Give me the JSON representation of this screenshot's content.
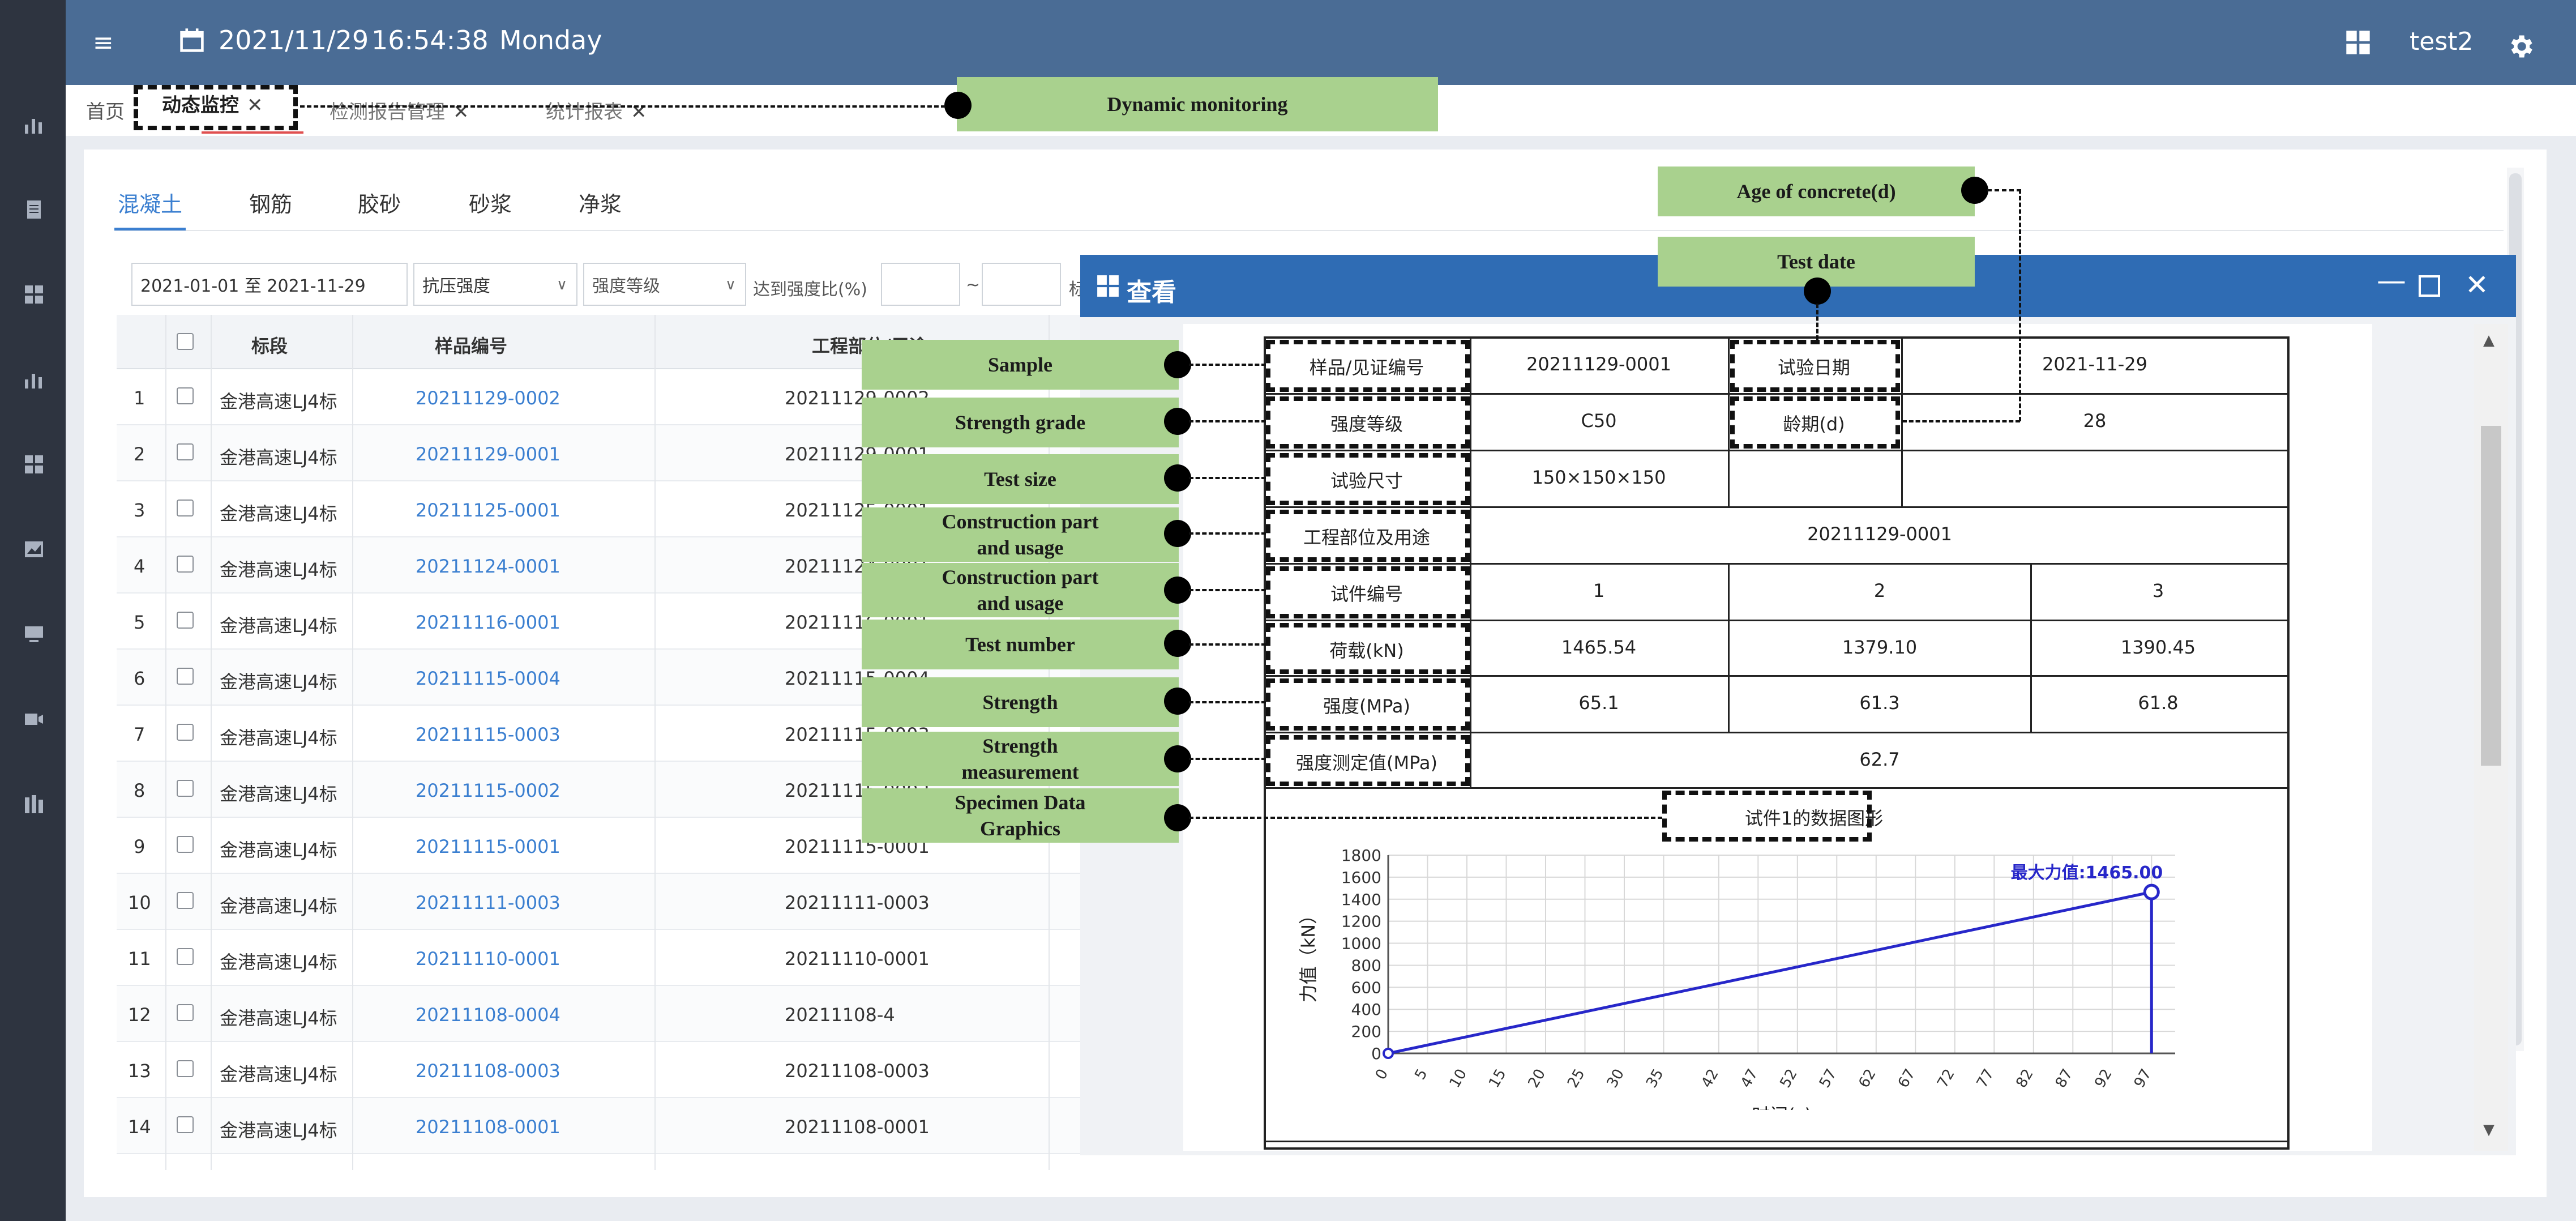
{
  "header": {
    "menu_glyph": "≡",
    "date": "2021/11/29",
    "time": "16:54:38",
    "weekday": "Monday",
    "user": "test2"
  },
  "tabs": {
    "home": "首页",
    "active": "动态监控",
    "reports": "检测报告管理",
    "stats": "统计报表",
    "close_glyph": "✕"
  },
  "subtabs": [
    "混凝土",
    "钢筋",
    "胶砂",
    "砂浆",
    "净浆"
  ],
  "filters": {
    "date_range": "2021-01-01 至 2021-11-29",
    "strength_type": "抗压强度",
    "grade_placeholder": "强度等级",
    "ratio_label": "达到强度比(%)",
    "tilde": "~",
    "cut_label": "标"
  },
  "table": {
    "headers": {
      "section": "标段",
      "sample": "样品编号",
      "part": "工程部位/用途"
    },
    "rows": [
      {
        "no": "1",
        "section": "金港高速LJ4标",
        "sample": "20211129-0002",
        "part": "20211129-0002"
      },
      {
        "no": "2",
        "section": "金港高速LJ4标",
        "sample": "20211129-0001",
        "part": "20211129-0001"
      },
      {
        "no": "3",
        "section": "金港高速LJ4标",
        "sample": "20211125-0001",
        "part": "20211125-0001"
      },
      {
        "no": "4",
        "section": "金港高速LJ4标",
        "sample": "20211124-0001",
        "part": "20211124-0001"
      },
      {
        "no": "5",
        "section": "金港高速LJ4标",
        "sample": "20211116-0001",
        "part": "20211116-0001"
      },
      {
        "no": "6",
        "section": "金港高速LJ4标",
        "sample": "20211115-0004",
        "part": "20211115-0004"
      },
      {
        "no": "7",
        "section": "金港高速LJ4标",
        "sample": "20211115-0003",
        "part": "20211115-0003"
      },
      {
        "no": "8",
        "section": "金港高速LJ4标",
        "sample": "20211115-0002",
        "part": "20211115-0002"
      },
      {
        "no": "9",
        "section": "金港高速LJ4标",
        "sample": "20211115-0001",
        "part": "20211115-0001"
      },
      {
        "no": "10",
        "section": "金港高速LJ4标",
        "sample": "20211111-0003",
        "part": "20211111-0003"
      },
      {
        "no": "11",
        "section": "金港高速LJ4标",
        "sample": "20211110-0001",
        "part": "20211110-0001"
      },
      {
        "no": "12",
        "section": "金港高速LJ4标",
        "sample": "20211108-0004",
        "part": "20211108-4"
      },
      {
        "no": "13",
        "section": "金港高速LJ4标",
        "sample": "20211108-0003",
        "part": "20211108-0003"
      },
      {
        "no": "14",
        "section": "金港高速LJ4标",
        "sample": "20211108-0001",
        "part": "20211108-0001"
      }
    ]
  },
  "dialog": {
    "title": "查看",
    "min_glyph": "—",
    "close_glyph": "✕",
    "report": {
      "sample_label": "样品/见证编号",
      "sample_value": "20211129-0001",
      "test_date_label": "试验日期",
      "test_date_value": "2021-11-29",
      "grade_label": "强度等级",
      "grade_value": "C50",
      "age_label": "龄期(d)",
      "age_value": "28",
      "size_label": "试验尺寸",
      "size_value": "150×150×150",
      "part_label": "工程部位及用途",
      "part_value": "20211129-0001",
      "specimen_label": "试件编号",
      "specimen_values": [
        "1",
        "2",
        "3"
      ],
      "load_label": "荷载(kN)",
      "load_values": [
        "1465.54",
        "1379.10",
        "1390.45"
      ],
      "strength_label": "强度(MPa)",
      "strength_values": [
        "65.1",
        "61.3",
        "61.8"
      ],
      "measured_label": "强度测定值(MPa)",
      "measured_value": "62.7",
      "graph_label": "试件1的数据图形"
    }
  },
  "chart_data": {
    "type": "line",
    "xlabel": "时间(s)",
    "ylabel": "力值（kN）",
    "ylim": [
      0,
      1800
    ],
    "yticks": [
      0,
      200,
      400,
      600,
      800,
      1000,
      1200,
      1400,
      1600,
      1800
    ],
    "xticks": [
      0,
      5,
      10,
      15,
      20,
      25,
      30,
      35,
      42,
      47,
      52,
      57,
      62,
      67,
      72,
      77,
      82,
      87,
      92,
      97
    ],
    "x": [
      0,
      97
    ],
    "series": [
      {
        "values": [
          0,
          1465
        ]
      }
    ],
    "drop": {
      "x": 97,
      "from": 1465,
      "to": 0
    },
    "max_label": "最大力值:1465.00",
    "line_color": "#2727c9",
    "grid": true
  },
  "annotations": {
    "dynamic": "Dynamic monitoring",
    "age": "Age of concrete(d)",
    "test_date": "Test date",
    "sample": "Sample",
    "strength_grade": "Strength grade",
    "test_size": "Test size",
    "part1_a": "Construction part",
    "part1_b": "and usage",
    "part2_a": "Construction part",
    "part2_b": "and usage",
    "test_number": "Test number",
    "strength": "Strength",
    "measure_a": "Strength",
    "measure_b": "measurement",
    "graphics_a": "Specimen Data",
    "graphics_b": "Graphics"
  },
  "colors": {
    "header": "#4a6c95",
    "dialog_header": "#2f6cb4",
    "link": "#3b7fd0",
    "annotation": "#a9d18e"
  }
}
